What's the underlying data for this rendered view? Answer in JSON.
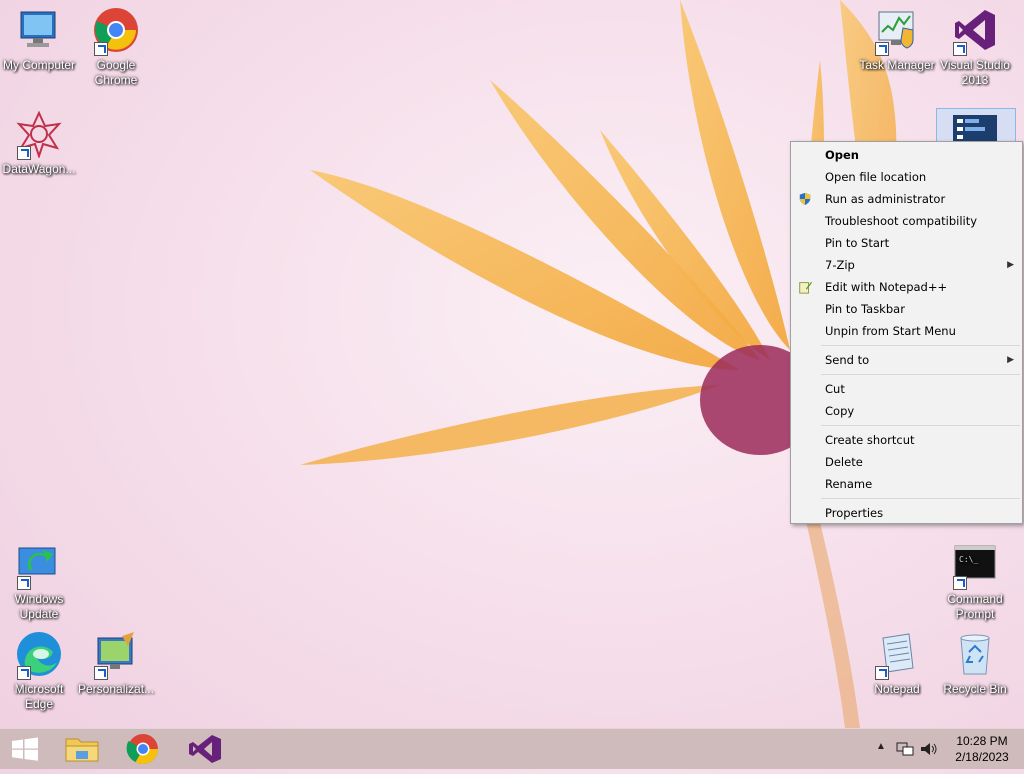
{
  "desktop": {
    "icons": {
      "my_computer": "My Computer",
      "google_chrome": "Google Chrome",
      "datawagon": "DataWagon...",
      "task_manager": "Task Manager",
      "visual_studio": "Visual Studio 2013",
      "windows_update": "Windows Update",
      "command_prompt": "Command Prompt",
      "microsoft_edge": "Microsoft Edge",
      "personalization": "Personalizat...",
      "notepad": "Notepad",
      "recycle_bin": "Recycle Bin"
    }
  },
  "context_menu": {
    "open": "Open",
    "open_file_location": "Open file location",
    "run_as_admin": "Run as administrator",
    "troubleshoot": "Troubleshoot compatibility",
    "pin_to_start": "Pin to Start",
    "seven_zip": "7-Zip",
    "edit_notepadpp": "Edit with Notepad++",
    "pin_to_taskbar": "Pin to Taskbar",
    "unpin_start_menu": "Unpin from Start Menu",
    "send_to": "Send to",
    "cut": "Cut",
    "copy": "Copy",
    "create_shortcut": "Create shortcut",
    "delete": "Delete",
    "rename": "Rename",
    "properties": "Properties"
  },
  "taskbar": {
    "time": "10:28 PM",
    "date": "2/18/2023"
  },
  "colors": {
    "taskbar": "#cdb9b9",
    "menu_bg": "#f2f2f2",
    "accent_blue": "#1a73e8",
    "vs_purple": "#68217a"
  }
}
